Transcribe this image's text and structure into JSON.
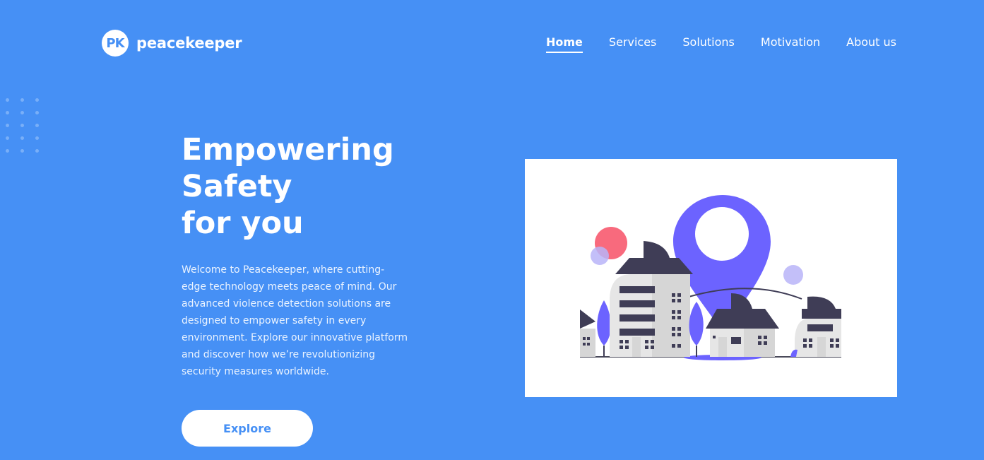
{
  "brand": {
    "logo_initials": "PK",
    "name": "peacekeeper"
  },
  "nav": {
    "items": [
      {
        "label": "Home",
        "active": true
      },
      {
        "label": "Services",
        "active": false
      },
      {
        "label": "Solutions",
        "active": false
      },
      {
        "label": "Motivation",
        "active": false
      },
      {
        "label": "About us",
        "active": false
      }
    ]
  },
  "hero": {
    "title_lines": [
      "Empowering",
      "Safety",
      "for you"
    ],
    "description": "Welcome to Peacekeeper, where cutting-edge technology meets peace of mind. Our advanced violence detection solutions are designed to empower safety in every environment. Explore our innovative platform and discover how we’re revolutionizing security measures worldwide.",
    "cta_label": "Explore"
  },
  "illustration": {
    "icon": "city-location-pin-illustration"
  },
  "colors": {
    "background": "#4690F5",
    "accent_purple": "#6C63FF",
    "dark_roof": "#3F3D56",
    "accent_pink": "#F86A7D"
  }
}
